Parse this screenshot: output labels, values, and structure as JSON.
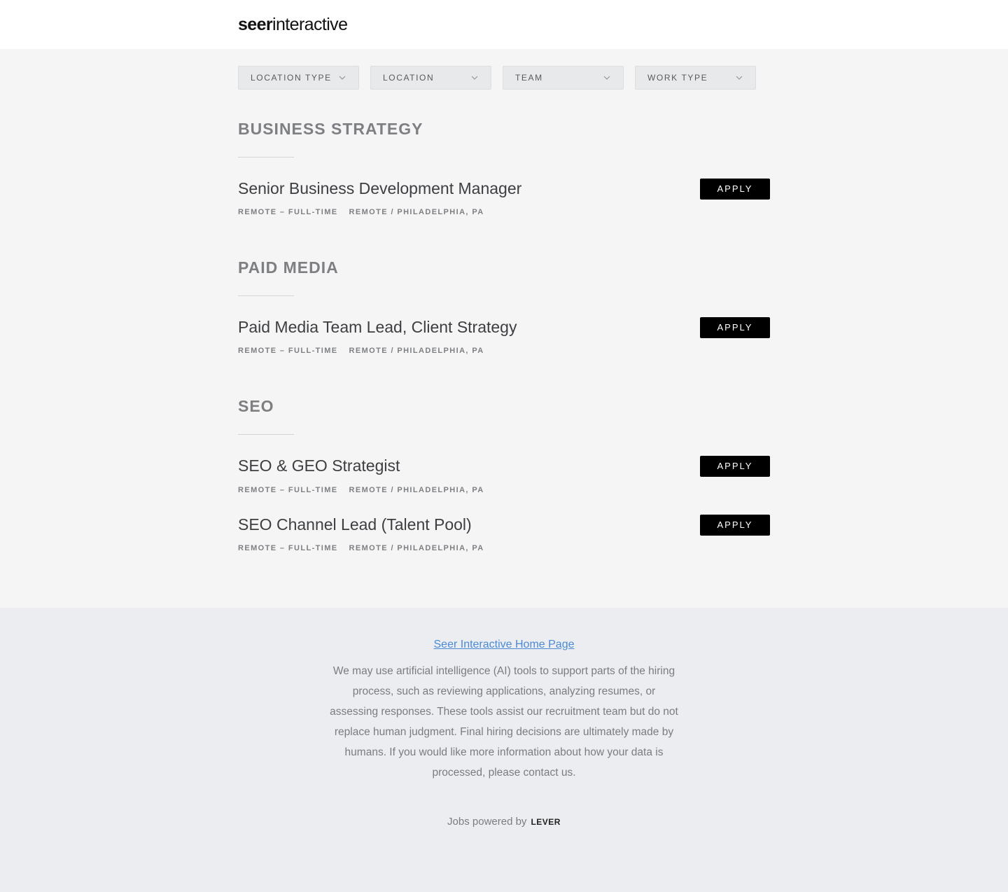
{
  "header": {
    "logo_bold": "seer",
    "logo_light": "interactive"
  },
  "filters": [
    {
      "label": "LOCATION TYPE"
    },
    {
      "label": "LOCATION"
    },
    {
      "label": "TEAM"
    },
    {
      "label": "WORK TYPE"
    }
  ],
  "groups": [
    {
      "title": "BUSINESS STRATEGY",
      "postings": [
        {
          "title": "Senior Business Development Manager",
          "type": "REMOTE – FULL-TIME",
          "location": "REMOTE / PHILADELPHIA, PA",
          "apply": "APPLY"
        }
      ]
    },
    {
      "title": "PAID MEDIA",
      "postings": [
        {
          "title": "Paid Media Team Lead, Client Strategy",
          "type": "REMOTE – FULL-TIME",
          "location": "REMOTE / PHILADELPHIA, PA",
          "apply": "APPLY"
        }
      ]
    },
    {
      "title": "SEO",
      "postings": [
        {
          "title": "SEO & GEO Strategist",
          "type": "REMOTE – FULL-TIME",
          "location": "REMOTE / PHILADELPHIA, PA",
          "apply": "APPLY"
        },
        {
          "title": "SEO Channel Lead (Talent Pool)",
          "type": "REMOTE – FULL-TIME",
          "location": "REMOTE / PHILADELPHIA, PA",
          "apply": "APPLY"
        }
      ]
    }
  ],
  "footer": {
    "home_link": "Seer Interactive Home Page",
    "disclaimer": "We may use artificial intelligence (AI) tools to support parts of the hiring process, such as reviewing applications, analyzing resumes, or assessing responses. These tools assist our recruitment team but do not replace human judgment. Final hiring decisions are ultimately made by humans. If you would like more information about how your data is processed, please contact us.",
    "powered_by": "Jobs powered by",
    "lever": "LEVER"
  },
  "colors": {
    "accent_link": "#4a8ad6",
    "apply_bg": "#000000",
    "page_bg": "#f5f5f6",
    "footer_bg": "#ebedf0"
  }
}
